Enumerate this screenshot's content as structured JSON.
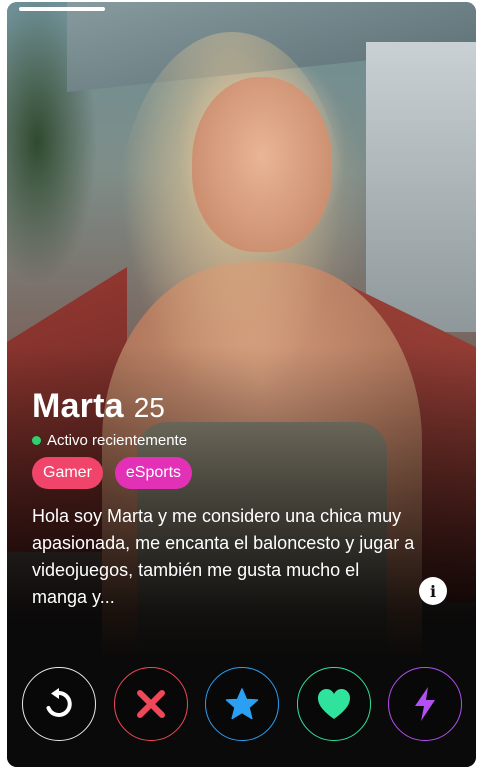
{
  "profile": {
    "name": "Marta",
    "age": "25",
    "status": "Activo recientemente",
    "tags": [
      "Gamer",
      "eSports"
    ],
    "bio": "Hola soy Marta y me considero una chica muy apasionada, me encanta el baloncesto y jugar a videojuegos, también me gusta mucho el manga y..."
  },
  "photo": {
    "current": 1
  },
  "info_button": {
    "label": "i"
  },
  "actions": [
    {
      "name": "rewind",
      "icon": "rewind-icon",
      "color": "#e9e9e9"
    },
    {
      "name": "nope",
      "icon": "close-x-icon",
      "color": "#f0475b"
    },
    {
      "name": "super-like",
      "icon": "star-icon",
      "color": "#2b9ff1"
    },
    {
      "name": "like",
      "icon": "heart-icon",
      "color": "#2fe39c"
    },
    {
      "name": "boost",
      "icon": "lightning-icon",
      "color": "#b34ff3"
    }
  ],
  "colors": {
    "active_dot": "#2fd16f",
    "tag_gamer": "#f0446a",
    "tag_esports": "#e231b6"
  }
}
